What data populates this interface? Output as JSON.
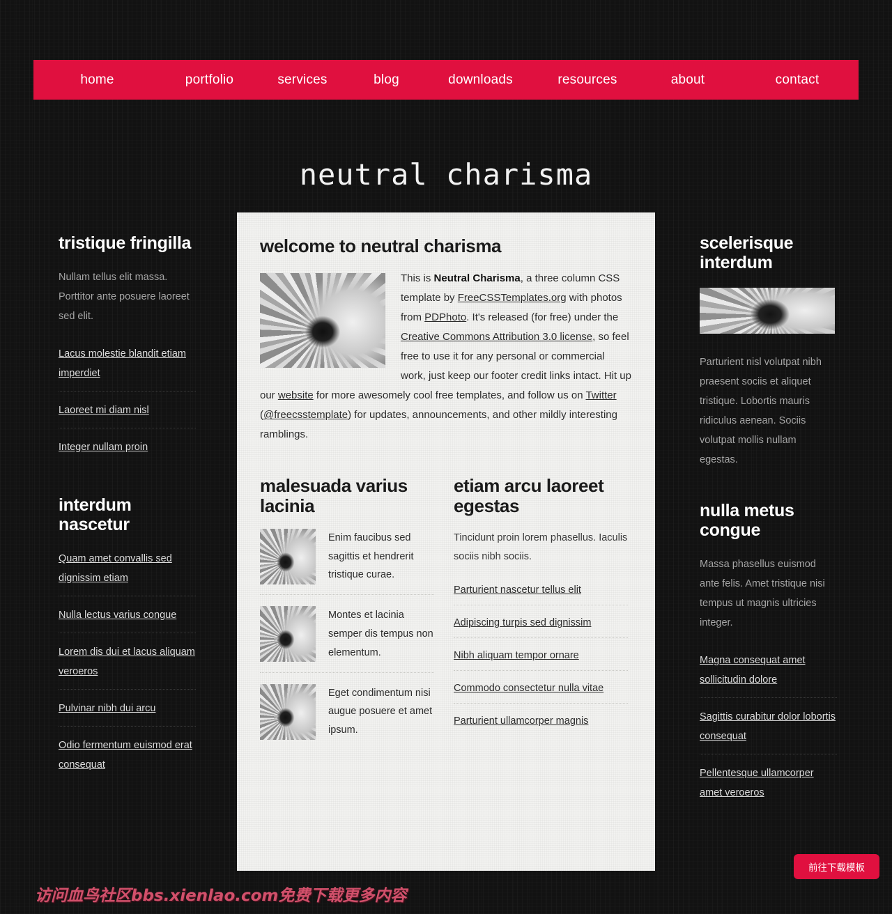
{
  "site": {
    "title": "neutral charisma"
  },
  "nav": {
    "items": [
      {
        "label": "home"
      },
      {
        "label": "portfolio"
      },
      {
        "label": "services"
      },
      {
        "label": "blog"
      },
      {
        "label": "downloads"
      },
      {
        "label": "resources"
      },
      {
        "label": "about"
      },
      {
        "label": "contact"
      }
    ]
  },
  "left_sidebar": {
    "section1": {
      "heading": "tristique fringilla",
      "paragraph": "Nullam tellus elit massa. Porttitor ante posuere laoreet sed elit.",
      "links": [
        "Lacus molestie blandit etiam imperdiet",
        "Laoreet mi diam nisl",
        "Integer nullam proin"
      ]
    },
    "section2": {
      "heading": "interdum nascetur",
      "links": [
        "Quam amet convallis sed dignissim etiam",
        "Nulla lectus varius congue",
        "Lorem dis dui et lacus aliquam veroeros",
        "Pulvinar nibh dui arcu",
        "Odio fermentum euismod erat consequat"
      ]
    }
  },
  "main": {
    "welcome": {
      "heading": "welcome to neutral charisma",
      "image_alt": "sunflower-photo",
      "text": {
        "p1": "This is ",
        "brand": "Neutral Charisma",
        "p2": ", a three column CSS template by ",
        "link1": "FreeCSSTemplates.org",
        "p3": " with photos from ",
        "link2": "PDPhoto",
        "p4": ". It's released (for free) under the ",
        "link3": "Creative Commons Attribution 3.0 license",
        "p5": ", so feel free to use it for any personal or commercial work, just keep our footer credit links intact. Hit up our ",
        "link4": "website",
        "p6": " for more awesomely cool free templates, and follow us on ",
        "link5": "Twitter",
        "p7": " (",
        "link6": "@freecsstemplate",
        "p8": ") for updates, announcements, and other mildly interesting ramblings."
      }
    },
    "col_left": {
      "heading": "malesuada varius lacinia",
      "items": [
        {
          "text": "Enim faucibus sed sagittis et hendrerit tristique curae."
        },
        {
          "text": "Montes et lacinia semper dis tempus non elementum."
        },
        {
          "text": "Eget condimentum nisi augue posuere et amet ipsum."
        }
      ]
    },
    "col_right": {
      "heading": "etiam arcu laoreet egestas",
      "intro": "Tincidunt proin lorem phasellus. Iaculis sociis nibh sociis.",
      "links": [
        "Parturient nascetur tellus elit",
        "Adipiscing turpis sed dignissim",
        "Nibh aliquam tempor ornare",
        "Commodo consectetur nulla vitae",
        "Parturient ullamcorper magnis"
      ]
    }
  },
  "right_sidebar": {
    "section1": {
      "heading": "scelerisque interdum",
      "image_alt": "sunflower-banner",
      "paragraph": "Parturient nisl volutpat nibh praesent sociis et aliquet tristique. Lobortis mauris ridiculus aenean. Sociis volutpat mollis nullam egestas."
    },
    "section2": {
      "heading": "nulla metus congue",
      "paragraph": "Massa phasellus euismod ante felis. Amet tristique nisi tempus ut magnis ultricies integer.",
      "links": [
        "Magna consequat amet sollicitudin dolore",
        "Sagittis curabitur dolor lobortis consequat",
        "Pellentesque ullamcorper amet veroeros"
      ]
    }
  },
  "footer": {
    "watermark": "访问血鸟社区bbs.xienlao.com免费下载更多内容",
    "download_button": "前往下载模板"
  },
  "colors": {
    "accent": "#e0103f",
    "background": "#121212",
    "panel": "#f2f2f0",
    "nav_text": "#ffffff",
    "watermark": "#d2506b"
  }
}
